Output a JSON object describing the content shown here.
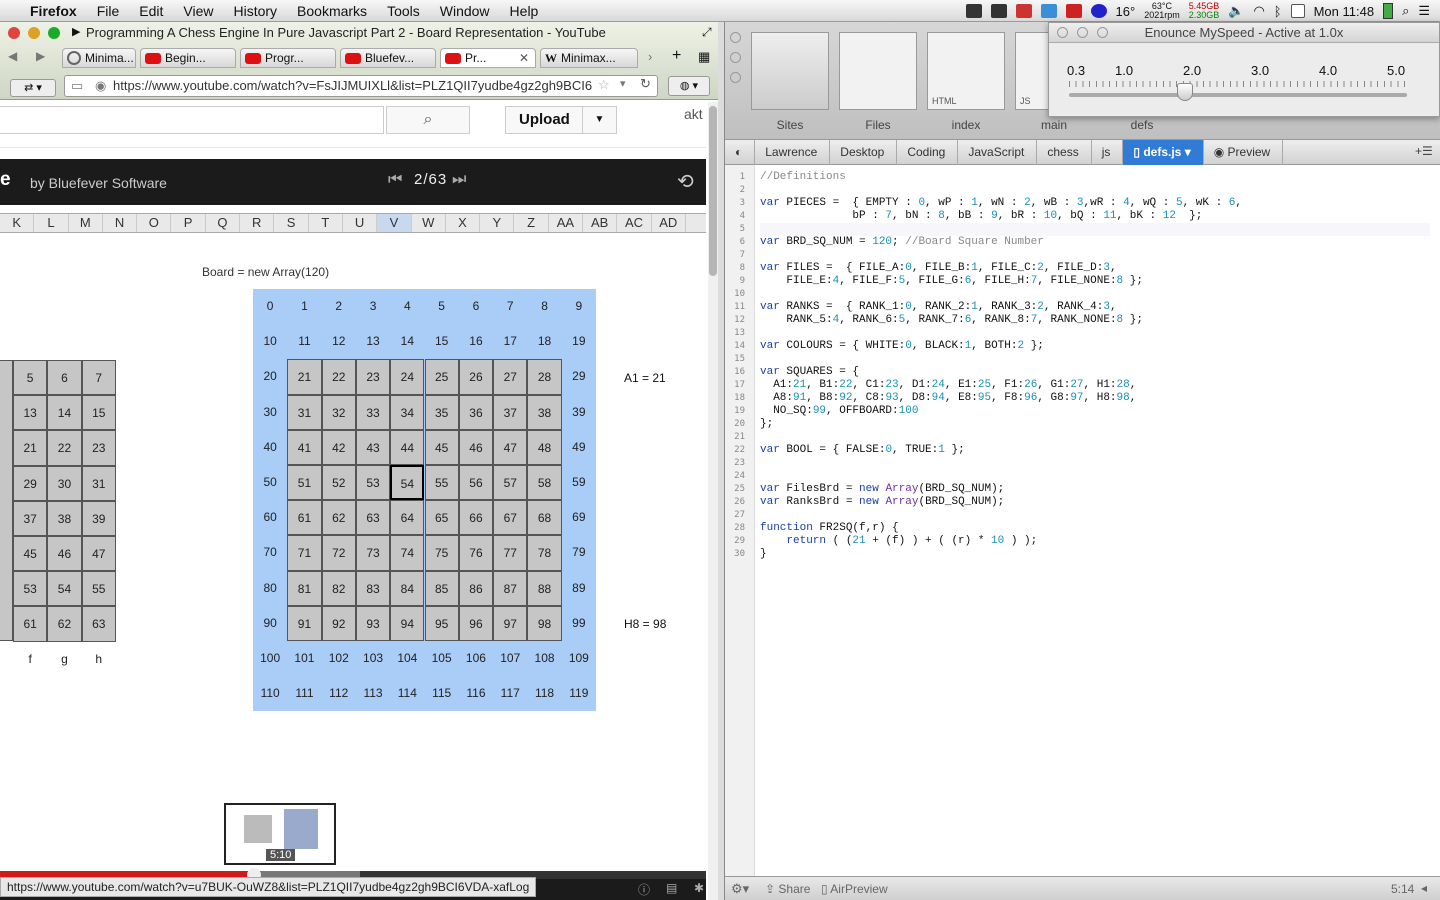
{
  "menubar": {
    "app": "Firefox",
    "items": [
      "File",
      "Edit",
      "View",
      "History",
      "Bookmarks",
      "Tools",
      "Window",
      "Help"
    ],
    "temp_cpu": "63°C",
    "rpm": "2021rpm",
    "mem_u": "5.45GB",
    "mem_f": "2.30GB",
    "weather": "16°",
    "clock": "Mon 11:48"
  },
  "browser": {
    "window_title": "Programming A Chess Engine In Pure Javascript Part 2 - Board Representation - YouTube",
    "tabs": [
      {
        "label": "Minima..."
      },
      {
        "label": "Begin..."
      },
      {
        "label": "Progr..."
      },
      {
        "label": "Bluefev..."
      },
      {
        "label": "Pr..."
      },
      {
        "label": "Minimax..."
      }
    ],
    "url": "https://www.youtube.com/watch?v=FsJIJMUIXLl&list=PLZ1QII7yudbe4gz2gh9BCI6",
    "status_url": "https://www.youtube.com/watch?v=u7BUK-OuWZ8&list=PLZ1QII7yudbe4gz2gh9BCI6VDA-xafLog"
  },
  "youtube": {
    "upload_label": "Upload",
    "user_partial": "akt",
    "playlist_partial": "e",
    "playlist_by": "by Bluefever Software",
    "playlist_position": "2/63",
    "preview_time": "5:10",
    "progress_fraction": 0.36
  },
  "video": {
    "column_headers": [
      "K",
      "L",
      "M",
      "N",
      "O",
      "P",
      "Q",
      "R",
      "S",
      "T",
      "U",
      "V",
      "W",
      "X",
      "Y",
      "Z",
      "AA",
      "AB",
      "AC",
      "AD"
    ],
    "selected_column": "V",
    "board_caption": "Board = new Array(120)",
    "a1_label": "A1 = 21",
    "h8_label": "H8 = 98",
    "highlighted_square": "54",
    "left_board_rows": [
      [
        "5",
        "6",
        "7"
      ],
      [
        "13",
        "14",
        "15"
      ],
      [
        "21",
        "22",
        "23"
      ],
      [
        "29",
        "30",
        "31"
      ],
      [
        "37",
        "38",
        "39"
      ],
      [
        "45",
        "46",
        "47"
      ],
      [
        "53",
        "54",
        "55"
      ],
      [
        "61",
        "62",
        "63"
      ]
    ],
    "left_file_labels": [
      "f",
      "g",
      "h"
    ]
  },
  "editor": {
    "thumbs": [
      {
        "label": "Sites"
      },
      {
        "label": "Files"
      },
      {
        "label": "index",
        "inner": "HTML"
      },
      {
        "label": "main",
        "inner": "JS"
      },
      {
        "label": "defs"
      }
    ],
    "breadcrumbs": [
      "Lawrence",
      "Desktop",
      "Coding",
      "JavaScript",
      "chess",
      "js",
      "defs.js",
      "Preview"
    ],
    "code_lines": [
      "//Definitions",
      "",
      "var PIECES =  { EMPTY : 0, wP : 1, wN : 2, wB : 3,wR : 4, wQ : 5, wK : 6,",
      "              bP : 7, bN : 8, bB : 9, bR : 10, bQ : 11, bK : 12  };",
      "",
      "var BRD_SQ_NUM = 120; //Board Square Number",
      "",
      "var FILES =  { FILE_A:0, FILE_B:1, FILE_C:2, FILE_D:3,",
      "    FILE_E:4, FILE_F:5, FILE_G:6, FILE_H:7, FILE_NONE:8 };",
      "",
      "var RANKS =  { RANK_1:0, RANK_2:1, RANK_3:2, RANK_4:3,",
      "    RANK_5:4, RANK_6:5, RANK_7:6, RANK_8:7, RANK_NONE:8 };",
      "",
      "var COLOURS = { WHITE:0, BLACK:1, BOTH:2 };",
      "",
      "var SQUARES = {",
      "  A1:21, B1:22, C1:23, D1:24, E1:25, F1:26, G1:27, H1:28,",
      "  A8:91, B8:92, C8:93, D8:94, E8:95, F8:96, G8:97, H8:98,",
      "  NO_SQ:99, OFFBOARD:100",
      "};",
      "",
      "var BOOL = { FALSE:0, TRUE:1 };",
      "",
      "",
      "var FilesBrd = new Array(BRD_SQ_NUM);",
      "var RanksBrd = new Array(BRD_SQ_NUM);",
      "",
      "function FR2SQ(f,r) {",
      "    return ( (21 + (f) ) + ( (r) * 10 ) );",
      "}"
    ],
    "share_label": "Share",
    "airpreview_label": "AirPreview",
    "cursor_pos": "5:14"
  },
  "enounce": {
    "title": "Enounce MySpeed - Active at 1.0x",
    "ticks": [
      "0.3",
      "1.0",
      "2.0",
      "3.0",
      "4.0",
      "5.0"
    ],
    "speed": 1.0
  }
}
